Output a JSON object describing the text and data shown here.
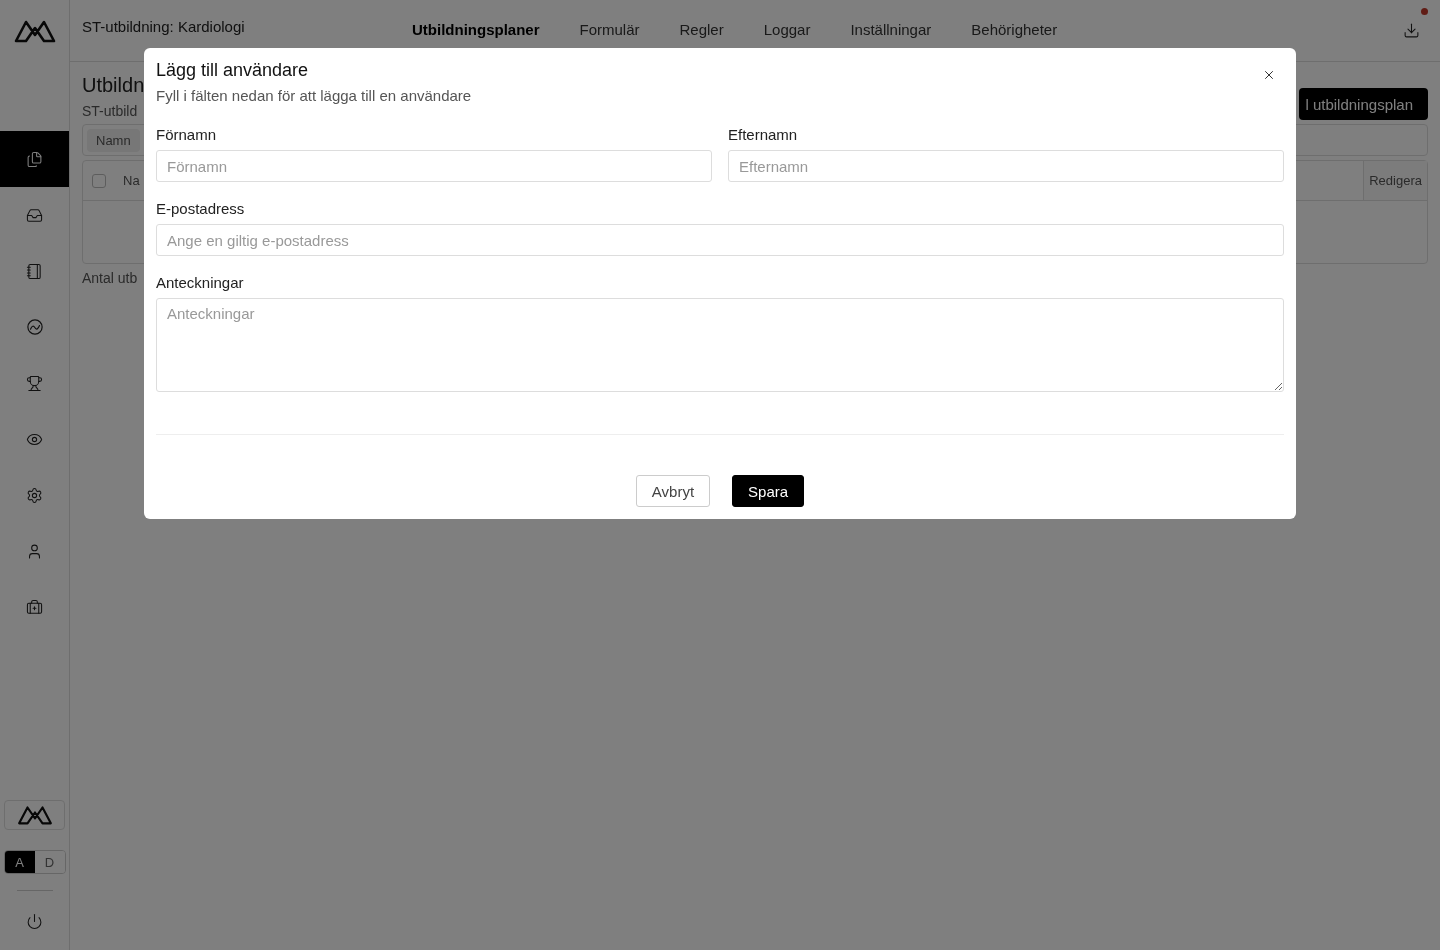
{
  "header": {
    "title": "ST-utbildning: Kardiologi",
    "tabs": [
      {
        "label": "Utbildningsplaner",
        "selected": true
      },
      {
        "label": "Formulär",
        "selected": false
      },
      {
        "label": "Regler",
        "selected": false
      },
      {
        "label": "Loggar",
        "selected": false
      },
      {
        "label": "Inställningar",
        "selected": false
      },
      {
        "label": "Behörigheter",
        "selected": false
      }
    ]
  },
  "sidebar": {
    "items": [
      {
        "selected": true
      },
      {
        "selected": false
      },
      {
        "selected": false
      },
      {
        "selected": false
      },
      {
        "selected": false
      },
      {
        "selected": false
      },
      {
        "selected": false
      },
      {
        "selected": false
      },
      {
        "selected": false
      }
    ],
    "mode_toggle": [
      {
        "label": "A",
        "selected": true
      },
      {
        "label": "D",
        "selected": false
      }
    ]
  },
  "page": {
    "title": "Utbildn",
    "subtitle": "ST-utbild",
    "add_button": "l utbildningsplan",
    "filter_chip": "Namn",
    "table": {
      "select_all": {
        "checked": false
      },
      "columns": [
        "Na",
        "Redigera"
      ]
    },
    "footer": "Antal utb"
  },
  "dialog": {
    "title": "Lägg till användare",
    "subtitle": "Fyll i fälten nedan för att lägga till en användare",
    "rows": [
      [
        {
          "label": "Förnamn",
          "placeholder": "Förnamn",
          "kind": "input"
        },
        {
          "label": "Efternamn",
          "placeholder": "Efternamn",
          "kind": "input"
        }
      ],
      [
        {
          "label": "E-postadress",
          "placeholder": "Ange en giltig e-postadress",
          "kind": "input"
        }
      ],
      [
        {
          "label": "Anteckningar",
          "placeholder": "Anteckningar",
          "kind": "textarea"
        }
      ]
    ],
    "buttons": [
      {
        "label": "Avbryt",
        "kind": "secondary"
      },
      {
        "label": "Spara",
        "kind": "primary"
      }
    ]
  }
}
